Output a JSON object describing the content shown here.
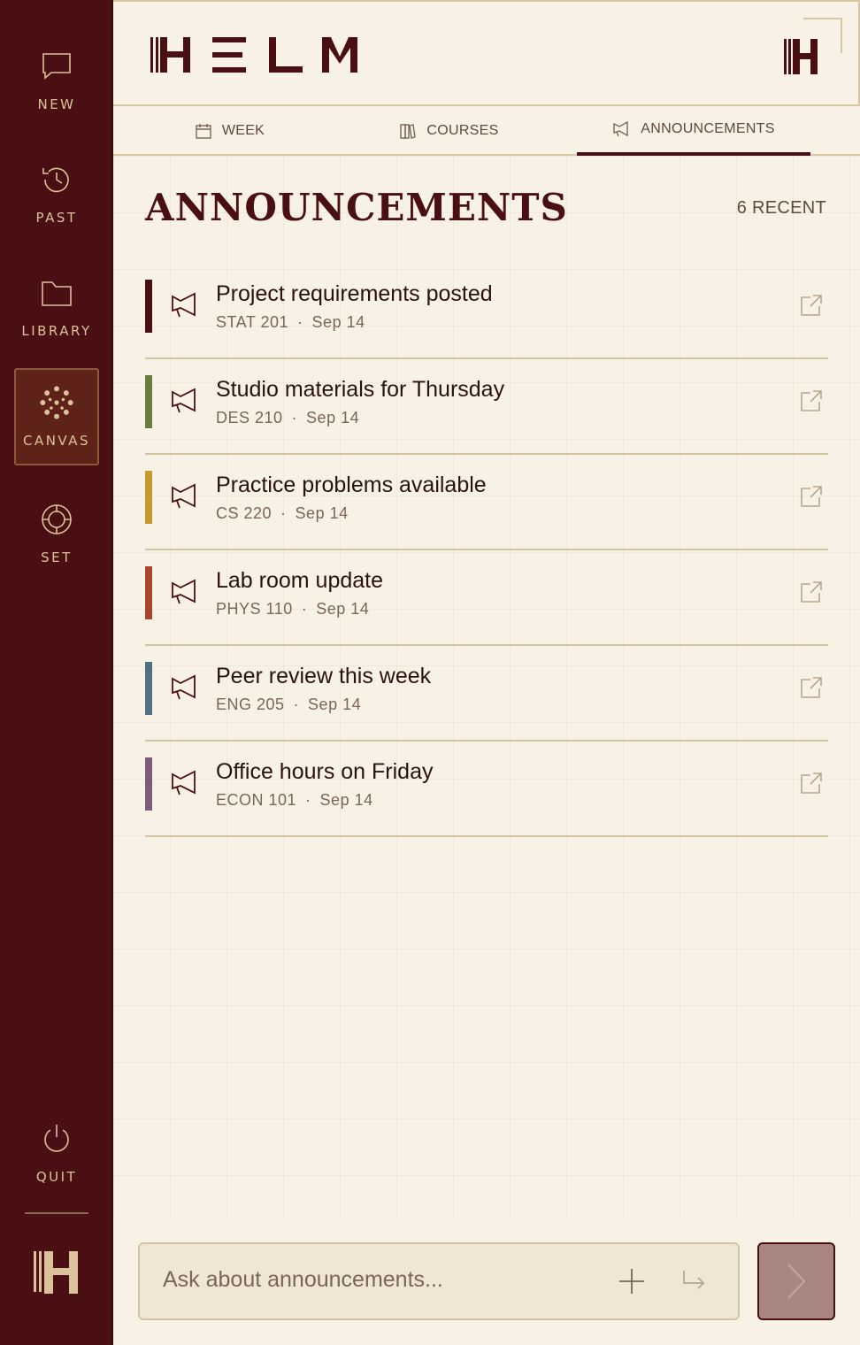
{
  "app": {
    "logo_text": "HELM"
  },
  "sidebar": {
    "items": [
      {
        "label": "NEW",
        "icon": "chat-bubble-icon"
      },
      {
        "label": "PAST",
        "icon": "history-icon"
      },
      {
        "label": "LIBRARY",
        "icon": "folder-icon"
      },
      {
        "label": "CANVAS",
        "icon": "canvas-logo-icon",
        "active": true
      },
      {
        "label": "SET",
        "icon": "settings-icon"
      }
    ],
    "quit_label": "QUIT"
  },
  "tabs": [
    {
      "label": "WEEK",
      "icon": "calendar-icon"
    },
    {
      "label": "COURSES",
      "icon": "books-icon"
    },
    {
      "label": "ANNOUNCEMENTS",
      "icon": "megaphone-icon",
      "active": true
    }
  ],
  "page": {
    "title": "ANNOUNCEMENTS",
    "recent_count": "6 RECENT"
  },
  "announcements": [
    {
      "title": "Project requirements posted",
      "course": "STAT 201",
      "date": "Sep 14",
      "color": "#4a0f12"
    },
    {
      "title": "Studio materials for Thursday",
      "course": "DES 210",
      "date": "Sep 14",
      "color": "#6a7d3f"
    },
    {
      "title": "Practice problems available",
      "course": "CS 220",
      "date": "Sep 14",
      "color": "#c79a2e"
    },
    {
      "title": "Lab room update",
      "course": "PHYS 110",
      "date": "Sep 14",
      "color": "#a8452a"
    },
    {
      "title": "Peer review this week",
      "course": "ENG 205",
      "date": "Sep 14",
      "color": "#4f7082"
    },
    {
      "title": "Office hours on Friday",
      "course": "ECON 101",
      "date": "Sep 14",
      "color": "#7d5a7a"
    }
  ],
  "composer": {
    "placeholder": "Ask about announcements..."
  },
  "colors": {
    "sidebar_bg": "#4a0f12",
    "accent_gold": "#dcc29a",
    "page_bg": "#f8f1e6"
  }
}
